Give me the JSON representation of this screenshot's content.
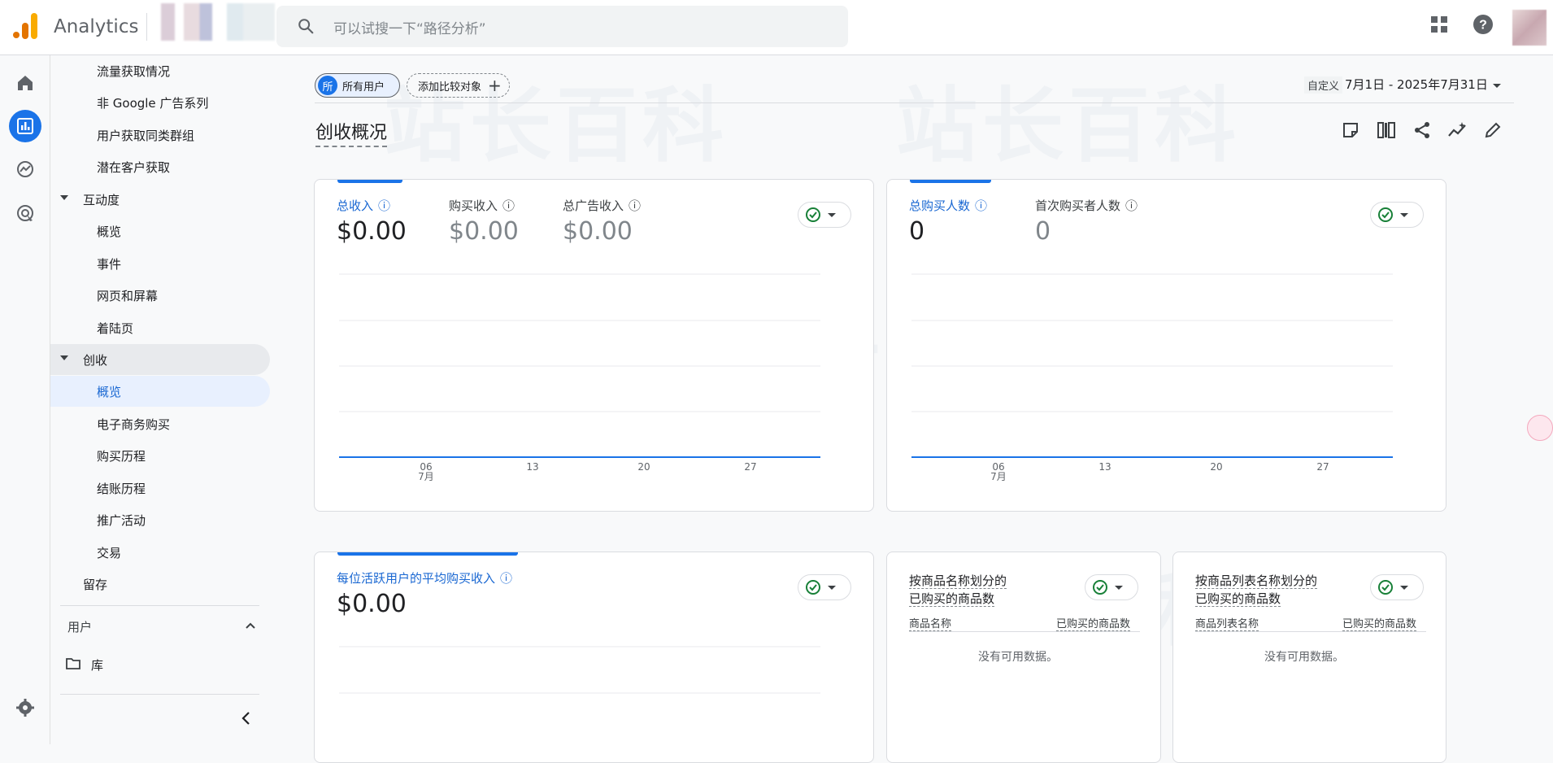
{
  "app": {
    "title": "Analytics"
  },
  "search": {
    "placeholder": "可以试搜一下“路径分析”"
  },
  "nav": {
    "items": [
      {
        "label": "流量获取情况"
      },
      {
        "label": "非 Google 广告系列"
      },
      {
        "label": "用户获取同类群组"
      },
      {
        "label": "潜在客户获取"
      },
      {
        "label": "互动度"
      },
      {
        "label": "概览"
      },
      {
        "label": "事件"
      },
      {
        "label": "网页和屏幕"
      },
      {
        "label": "着陆页"
      },
      {
        "label": "创收"
      },
      {
        "label": "概览"
      },
      {
        "label": "电子商务购买"
      },
      {
        "label": "购买历程"
      },
      {
        "label": "结账历程"
      },
      {
        "label": "推广活动"
      },
      {
        "label": "交易"
      },
      {
        "label": "留存"
      }
    ],
    "group_users": "用户",
    "library": "库"
  },
  "filters": {
    "badge": "所",
    "all_users": "所有用户",
    "add_compare": "添加比较对象"
  },
  "date": {
    "custom": "自定义",
    "range": "7月1日 - 2025年7月31日"
  },
  "page_title": "创收概况",
  "cards": {
    "revenue": {
      "metrics": [
        {
          "label": "总收入",
          "value": "$0.00"
        },
        {
          "label": "购买收入",
          "value": "$0.00"
        },
        {
          "label": "总广告收入",
          "value": "$0.00"
        }
      ],
      "x_ticks": [
        "06",
        "13",
        "20",
        "27"
      ],
      "x_month": "7月"
    },
    "buyers": {
      "metrics": [
        {
          "label": "总购买人数",
          "value": "0"
        },
        {
          "label": "首次购买者人数",
          "value": "0"
        }
      ],
      "x_ticks": [
        "06",
        "13",
        "20",
        "27"
      ],
      "x_month": "7月"
    },
    "arppu": {
      "metrics": [
        {
          "label": "每位活跃用户的平均购买收入",
          "value": "$0.00"
        }
      ]
    },
    "by_item_name": {
      "title_line1": "按商品名称划分的",
      "title_line2": "已购买的商品数",
      "col1": "商品名称",
      "col2": "已购买的商品数",
      "empty": "没有可用数据。"
    },
    "by_item_list": {
      "title_line1": "按商品列表名称划分的",
      "title_line2": "已购买的商品数",
      "col1": "商品列表名称",
      "col2": "已购买的商品数",
      "empty": "没有可用数据。"
    }
  },
  "chart_data": [
    {
      "type": "line",
      "x": [
        "7月1日",
        "7月31日"
      ],
      "series": [
        {
          "values": [
            0,
            0
          ]
        }
      ],
      "x_tick_labels": [
        "06 7月",
        "13",
        "20",
        "27"
      ]
    },
    {
      "type": "line",
      "x": [
        "7月1日",
        "7月31日"
      ],
      "series": [
        {
          "values": [
            0,
            0
          ]
        }
      ],
      "x_tick_labels": [
        "06 7月",
        "13",
        "20",
        "27"
      ]
    }
  ],
  "colors": {
    "accent": "#1a73e8",
    "success": "#188038"
  }
}
